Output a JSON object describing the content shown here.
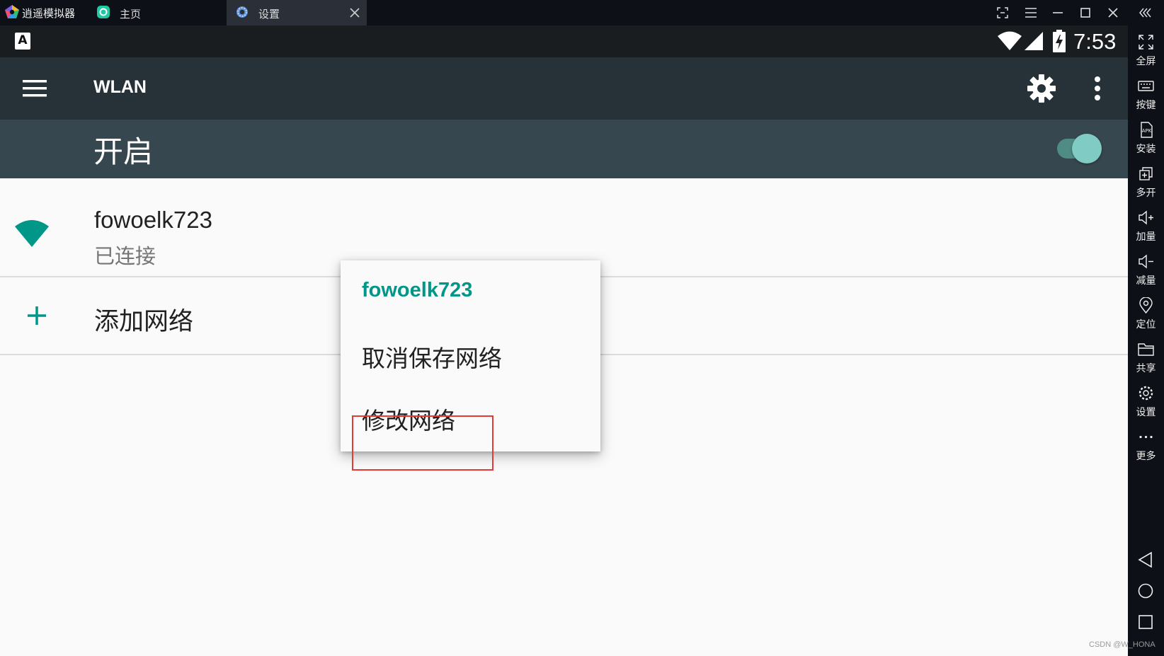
{
  "window": {
    "app_name": "逍遥模拟器",
    "tabs": [
      {
        "label": "主页",
        "icon": "home-app-icon"
      },
      {
        "label": "设置",
        "icon": "settings-gear-icon",
        "active": true
      }
    ]
  },
  "toolbar": {
    "items": [
      {
        "label": "全屏",
        "icon": "fullscreen-icon"
      },
      {
        "label": "按键",
        "icon": "keyboard-icon"
      },
      {
        "label": "安装",
        "icon": "apk-icon"
      },
      {
        "label": "多开",
        "icon": "multi-instance-icon"
      },
      {
        "label": "加量",
        "icon": "volume-up-icon"
      },
      {
        "label": "减量",
        "icon": "volume-down-icon"
      },
      {
        "label": "定位",
        "icon": "location-pin-icon"
      },
      {
        "label": "共享",
        "icon": "folder-icon"
      },
      {
        "label": "设置",
        "icon": "gear-icon"
      },
      {
        "label": "更多",
        "icon": "more-dots-icon"
      }
    ]
  },
  "statusbar": {
    "time": "7:53",
    "notify_glyph": "A"
  },
  "appbar": {
    "title": "WLAN"
  },
  "switchbar": {
    "label": "开启",
    "enabled": true
  },
  "network": {
    "name": "fowoelk723",
    "status": "已连接"
  },
  "add_network": {
    "label": "添加网络"
  },
  "dialog": {
    "title": "fowoelk723",
    "items": [
      "取消保存网络",
      "修改网络"
    ]
  },
  "colors": {
    "accent": "#009688",
    "appbar": "#263238",
    "switchbar": "#37474f",
    "highlight": "#e53935"
  },
  "watermark": "CSDN @W_HONA"
}
